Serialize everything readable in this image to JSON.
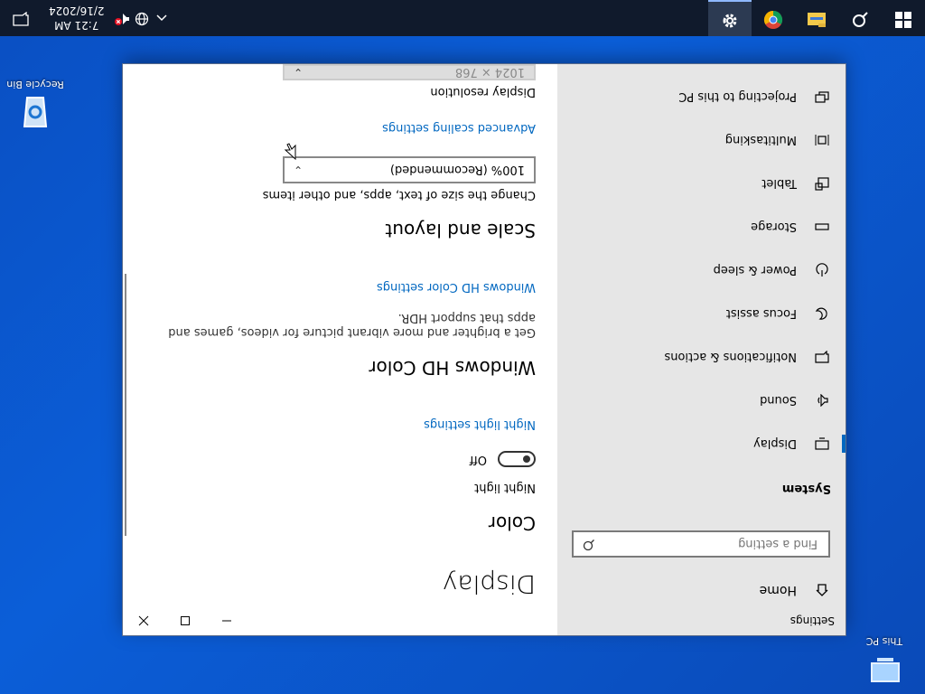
{
  "desktop": {
    "icons": [
      {
        "label": "This PC"
      },
      {
        "label": "Recycle Bin"
      }
    ]
  },
  "taskbar": {
    "pinned": [
      "windows-start",
      "search",
      "file-explorer",
      "chrome",
      "settings"
    ],
    "clock": {
      "time": "7:21 AM",
      "date": "2/16/2024"
    }
  },
  "window": {
    "title": "Settings",
    "nav": {
      "home_label": "Home",
      "search_placeholder": "Find a setting",
      "section": "System",
      "items": [
        {
          "label": "Display"
        },
        {
          "label": "Sound"
        },
        {
          "label": "Notifications & actions"
        },
        {
          "label": "Focus assist"
        },
        {
          "label": "Power & sleep"
        },
        {
          "label": "Storage"
        },
        {
          "label": "Tablet"
        },
        {
          "label": "Multitasking"
        },
        {
          "label": "Projecting to this PC"
        }
      ]
    },
    "content": {
      "title": "Display",
      "color_heading": "Color",
      "night_light_label": "Night light",
      "night_light_state": "Off",
      "night_light_link": "Night light settings",
      "hd_heading": "Windows HD Color",
      "hd_desc": "Get a brighter and more vibrant picture for videos, games and apps that support HDR.",
      "hd_link": "Windows HD Color settings",
      "scale_heading": "Scale and layout",
      "scale_label": "Change the size of text, apps, and other items",
      "scale_value": "100% (Recommended)",
      "advanced_link": "Advanced scaling settings",
      "resolution_label": "Display resolution",
      "resolution_value": "1024 × 768"
    }
  }
}
